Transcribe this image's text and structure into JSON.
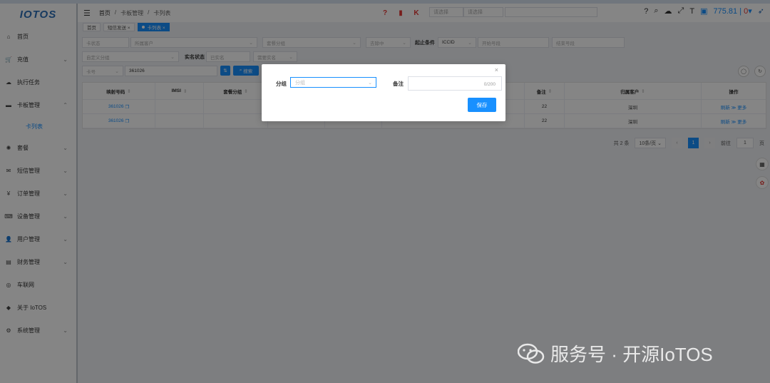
{
  "logo": {
    "text": "IOTOS"
  },
  "sidebar": {
    "items": [
      {
        "icon": "home-icon",
        "glyph": "⌂",
        "label": "首页",
        "caret": ""
      },
      {
        "icon": "cart-icon",
        "glyph": "🛒",
        "label": "充值",
        "caret": "⌄"
      },
      {
        "icon": "cloud-icon",
        "glyph": "☁",
        "label": "执行任务",
        "caret": ""
      },
      {
        "icon": "card-icon",
        "glyph": "▬",
        "label": "卡板管理",
        "caret": "⌃"
      },
      {
        "icon": "package-icon",
        "glyph": "✺",
        "label": "套餐",
        "caret": "⌄"
      },
      {
        "icon": "mail-icon",
        "glyph": "✉",
        "label": "短信管理",
        "caret": "⌄"
      },
      {
        "icon": "yen-icon",
        "glyph": "¥",
        "label": "订单管理",
        "caret": "⌄"
      },
      {
        "icon": "device-icon",
        "glyph": "⌨",
        "label": "设备管理",
        "caret": "⌄"
      },
      {
        "icon": "user-icon",
        "glyph": "👤",
        "label": "用户管理",
        "caret": "⌄"
      },
      {
        "icon": "finance-icon",
        "glyph": "▤",
        "label": "财务管理",
        "caret": "⌄"
      },
      {
        "icon": "network-icon",
        "glyph": "◎",
        "label": "车联网",
        "caret": ""
      },
      {
        "icon": "info-icon",
        "glyph": "◆",
        "label": "关于 IoTOS",
        "caret": ""
      },
      {
        "icon": "gear-icon",
        "glyph": "⚙",
        "label": "系统管理",
        "caret": "⌄"
      }
    ],
    "sub_item": "卡列表"
  },
  "header": {
    "breadcrumb": [
      "首页",
      "/",
      "卡板管理",
      "/",
      "卡列表"
    ],
    "select1_placeholder": "请选择",
    "select2_placeholder": "请选择",
    "balance": "775.81",
    "zero": "0"
  },
  "tags": [
    {
      "label": "首页",
      "active": false
    },
    {
      "label": "短信发送 ×",
      "active": false
    },
    {
      "label": "卡列表 ×",
      "active": true
    }
  ],
  "filters": {
    "card_status": "卡状态",
    "owner": "所属客户",
    "package_group": "套餐分组",
    "state": "去除中",
    "range_label": "起止条件",
    "range_value": "ICCID",
    "start_no": "开始号段",
    "end_no": "结束号段",
    "custom_group": "自定义分组",
    "realname_label": "实名状态",
    "realname_value": "已实名",
    "need_realname": "需要实名",
    "card_no_type": "卡号",
    "card_no_value": "361026",
    "search_label": "搜索"
  },
  "table": {
    "headers": [
      "映射号码",
      "IMSI",
      "套餐分组",
      "",
      "",
      "",
      "备注",
      "归属客户",
      "操作"
    ],
    "rows": [
      {
        "mapped": "361026",
        "remark": "22",
        "customer": "深圳",
        "actions": "刷新 ≫ 更多"
      },
      {
        "mapped": "361026",
        "remark": "22",
        "customer": "深圳",
        "actions": "刷新 ≫ 更多"
      }
    ]
  },
  "pager": {
    "total": "共 2 条",
    "page_size": "10条/页",
    "current": "1",
    "goto_label": "前往",
    "goto_value": "1",
    "page_suffix": "页"
  },
  "modal": {
    "group_label": "分组",
    "group_placeholder": "分组",
    "remark_label": "备注",
    "remark_count": "0/200",
    "save_label": "保存"
  },
  "watermark": {
    "text": "服务号 · 开源IoTOS"
  },
  "colors": {
    "primary": "#1890ff",
    "danger": "#e53935",
    "overlay": "rgba(0,0,0,0.48)"
  }
}
